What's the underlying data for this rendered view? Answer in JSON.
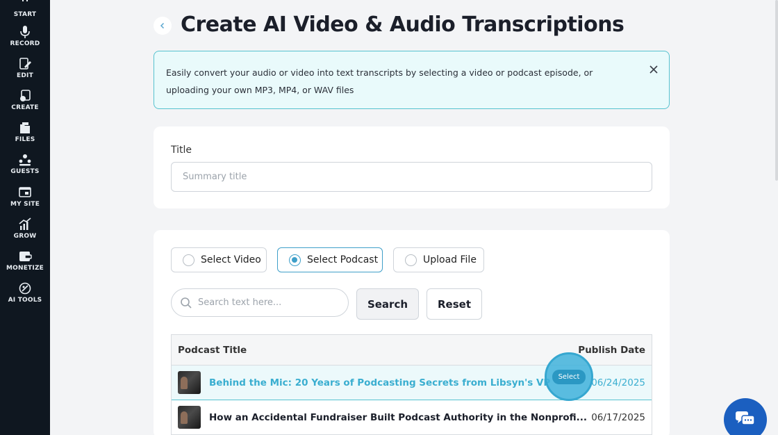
{
  "sidebar": {
    "items": [
      {
        "label": "START",
        "icon": "start-icon"
      },
      {
        "label": "RECORD",
        "icon": "microphone-icon"
      },
      {
        "label": "EDIT",
        "icon": "edit-icon"
      },
      {
        "label": "CREATE",
        "icon": "create-icon"
      },
      {
        "label": "FILES",
        "icon": "files-icon"
      },
      {
        "label": "GUESTS",
        "icon": "guests-icon"
      },
      {
        "label": "MY SITE",
        "icon": "site-icon"
      },
      {
        "label": "GROW",
        "icon": "grow-icon"
      },
      {
        "label": "MONETIZE",
        "icon": "monetize-icon"
      },
      {
        "label": "AI TOOLS",
        "icon": "ai-tools-icon"
      }
    ]
  },
  "header": {
    "title": "Create AI Video & Audio Transcriptions",
    "back_icon": "chevron-left-icon"
  },
  "info": {
    "text": "Easily convert your audio or video into text transcripts by selecting a video or podcast episode, or uploading your own MP3, MP4, or WAV files",
    "close_icon": "close-icon"
  },
  "title_field": {
    "label": "Title",
    "placeholder": "Summary title",
    "value": ""
  },
  "source_options": {
    "video": "Select Video",
    "podcast": "Select Podcast",
    "upload": "Upload File",
    "selected": "podcast"
  },
  "search": {
    "placeholder": "Search text here...",
    "search_label": "Search",
    "reset_label": "Reset"
  },
  "table": {
    "headers": {
      "title": "Podcast Title",
      "date": "Publish Date"
    },
    "rows": [
      {
        "title": "Behind the Mic: 20 Years of Podcasting Secrets from Libsyn's VP",
        "date": "06/24/2025",
        "selected": true
      },
      {
        "title": "How an Accidental Fundraiser Built Podcast Authority in the Nonprofi...",
        "date": "06/17/2025",
        "selected": false
      }
    ],
    "select_label": "Select"
  },
  "colors": {
    "accent": "#3aaed0",
    "sidebar_bg": "#0f1720",
    "info_border": "#55c2cf",
    "chat": "#1b5fc0"
  }
}
